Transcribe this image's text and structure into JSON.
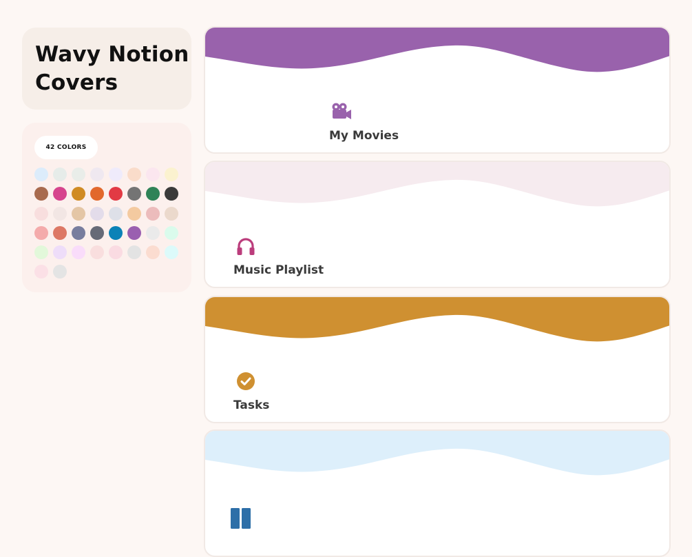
{
  "sidebar": {
    "title_line1": "Wavy Notion",
    "title_line2": "Covers",
    "colors_label": "42 COLORS",
    "swatches": [
      "#dcecfb",
      "#e6ece9",
      "#e9ede9",
      "#efe8f0",
      "#efebfb",
      "#fadcca",
      "#fbe6ef",
      "#fbf2cf",
      "#a86a4e",
      "#d6448d",
      "#d08b24",
      "#e2682c",
      "#e23a44",
      "#747474",
      "#2f8357",
      "#3a3a3a",
      "#f8dede",
      "#f2e6e4",
      "#e4c6a6",
      "#e3dcea",
      "#dee0e8",
      "#f4caa0",
      "#ecbcbc",
      "#ebd9cc",
      "#f4abab",
      "#dd7865",
      "#787d9e",
      "#666a77",
      "#0b82b7",
      "#9a5fb0",
      "#eaeaea",
      "#dafbec",
      "#e2f8da",
      "#eeddf9",
      "#f9dcfa",
      "#f9dede",
      "#fadbe2",
      "#e3e3e3",
      "#fbdcd0",
      "#dcfafa",
      "#fbe0e6",
      "#e4e4e4"
    ]
  },
  "cards": [
    {
      "title": "My Movies",
      "color": "#9962ac",
      "icon": "movie-camera-icon"
    },
    {
      "title": "Music Playlist",
      "color": "#f6ebef",
      "icon": "headphones-icon"
    },
    {
      "title": "Tasks",
      "color": "#cf9031",
      "icon": "check-circle-icon"
    },
    {
      "title": "",
      "color": "#ddeffb",
      "icon": "book-icon"
    }
  ],
  "icon_colors": {
    "movies": "#9962ac",
    "music": "#bb3d7c",
    "tasks": "#cf9031",
    "book": "#2d6fa8"
  }
}
